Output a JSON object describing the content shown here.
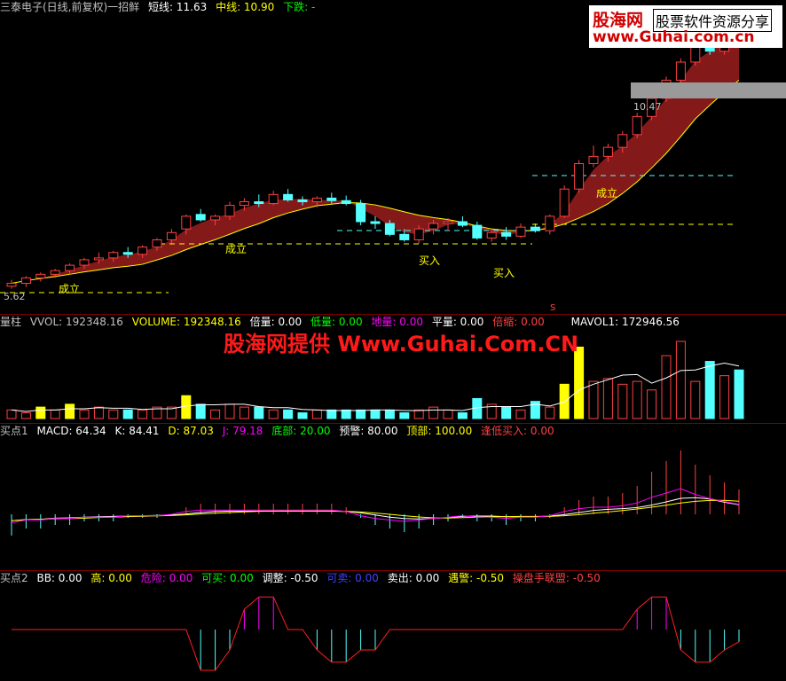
{
  "main": {
    "title": "三泰电子(日线,前复权)一招鲜",
    "short": "短线: 11.63",
    "mid": "中线: 10.90",
    "down": "下跌: -",
    "price_high": "10.47",
    "price_low": "5.62",
    "label_chengli": "成立",
    "label_buy": "买入",
    "label_s": "S"
  },
  "volume": {
    "name": "量柱",
    "vol": "VVOL: 192348.16",
    "volume": "VOLUME: 192348.16",
    "beiliang": "倍量: 0.00",
    "diliang": "低量: 0.00",
    "diliang2": "地量: 0.00",
    "pingliang": "平量: 0.00",
    "beisuo": "倍缩: 0.00",
    "mavol": "MAVOL1: 172946.56"
  },
  "macd": {
    "name": "买点1",
    "macd": "MACD: 64.34",
    "k": "K: 84.41",
    "d": "D: 87.03",
    "j": "J: 79.18",
    "dibu": "底部: 20.00",
    "yujing": "预警: 80.00",
    "dingbu": "顶部: 100.00",
    "fengdi": "逢低买入: 0.00"
  },
  "bb": {
    "name": "买点2",
    "bb": "BB: 0.00",
    "gao": "高: 0.00",
    "weixian": "危险: 0.00",
    "kemai": "可买: 0.00",
    "tiaozheng": "调整: -0.50",
    "kemai2": "可卖: 0.00",
    "maichu": "卖出: 0.00",
    "yujing": "遇警: -0.50",
    "caopan": "操盘手联盟: -0.50"
  },
  "watermark": {
    "big": "股海网提供 Www.Guhai.Com.CN",
    "logo_name": "股海网",
    "logo_tag": "股票软件资源分享",
    "logo_url": "www.Guhai.com.cn"
  },
  "colors": {
    "up": "#ff4040",
    "down": "#54ffff",
    "ribbon": "#8b1a1a",
    "yellow": "#ffff00"
  },
  "chart_data": {
    "type": "candlestick",
    "candles": [
      [
        5.62,
        5.8,
        5.55,
        5.7
      ],
      [
        5.7,
        5.9,
        5.6,
        5.85
      ],
      [
        5.85,
        6.0,
        5.75,
        5.95
      ],
      [
        5.95,
        6.1,
        5.85,
        6.05
      ],
      [
        6.05,
        6.25,
        5.95,
        6.2
      ],
      [
        6.2,
        6.4,
        6.1,
        6.35
      ],
      [
        6.35,
        6.55,
        6.25,
        6.4
      ],
      [
        6.4,
        6.6,
        6.3,
        6.55
      ],
      [
        6.55,
        6.7,
        6.4,
        6.5
      ],
      [
        6.5,
        6.75,
        6.4,
        6.7
      ],
      [
        6.7,
        6.95,
        6.6,
        6.9
      ],
      [
        6.9,
        7.2,
        6.8,
        7.1
      ],
      [
        7.2,
        7.6,
        7.05,
        7.55
      ],
      [
        7.6,
        7.75,
        7.4,
        7.45
      ],
      [
        7.45,
        7.6,
        7.3,
        7.55
      ],
      [
        7.55,
        7.95,
        7.45,
        7.85
      ],
      [
        7.85,
        8.05,
        7.7,
        7.95
      ],
      [
        7.95,
        8.15,
        7.8,
        7.9
      ],
      [
        7.9,
        8.25,
        7.85,
        8.15
      ],
      [
        8.15,
        8.3,
        7.95,
        8.0
      ],
      [
        8.0,
        8.1,
        7.85,
        7.95
      ],
      [
        7.95,
        8.1,
        7.8,
        8.05
      ],
      [
        8.05,
        8.2,
        7.9,
        7.98
      ],
      [
        7.98,
        8.12,
        7.85,
        7.9
      ],
      [
        7.9,
        8.0,
        7.3,
        7.4
      ],
      [
        7.4,
        7.55,
        7.2,
        7.35
      ],
      [
        7.35,
        7.45,
        7.0,
        7.05
      ],
      [
        7.05,
        7.2,
        6.85,
        6.9
      ],
      [
        6.9,
        7.3,
        6.8,
        7.2
      ],
      [
        7.2,
        7.45,
        7.05,
        7.35
      ],
      [
        7.35,
        7.5,
        7.15,
        7.4
      ],
      [
        7.4,
        7.55,
        7.25,
        7.3
      ],
      [
        7.3,
        7.4,
        6.9,
        6.95
      ],
      [
        6.95,
        7.2,
        6.85,
        7.1
      ],
      [
        7.1,
        7.25,
        6.9,
        7.0
      ],
      [
        7.0,
        7.35,
        6.95,
        7.25
      ],
      [
        7.25,
        7.35,
        7.1,
        7.15
      ],
      [
        7.15,
        7.6,
        7.05,
        7.55
      ],
      [
        7.55,
        8.4,
        7.5,
        8.3
      ],
      [
        8.3,
        9.1,
        8.2,
        9.0
      ],
      [
        9.0,
        9.5,
        8.9,
        9.2
      ],
      [
        9.2,
        9.55,
        9.05,
        9.45
      ],
      [
        9.45,
        9.9,
        9.3,
        9.8
      ],
      [
        9.8,
        10.4,
        9.7,
        10.3
      ],
      [
        10.3,
        10.9,
        10.2,
        10.8
      ],
      [
        10.8,
        11.4,
        10.7,
        11.3
      ],
      [
        11.3,
        11.9,
        11.2,
        11.8
      ],
      [
        11.8,
        12.5,
        11.7,
        12.4
      ],
      [
        12.4,
        12.6,
        12.0,
        12.1
      ],
      [
        12.1,
        12.7,
        12.0,
        12.6
      ],
      [
        12.6,
        12.8,
        12.3,
        12.45
      ]
    ],
    "volume": [
      3,
      2,
      4,
      3,
      5,
      3,
      4,
      3,
      3,
      3,
      4,
      4,
      8,
      5,
      3,
      5,
      4,
      4,
      3,
      3,
      2,
      3,
      3,
      3,
      3,
      3,
      3,
      2,
      3,
      4,
      3,
      2,
      7,
      5,
      4,
      3,
      6,
      4,
      12,
      25,
      13,
      14,
      12,
      13,
      10,
      22,
      27,
      13,
      20,
      15,
      17
    ],
    "macd": [
      -6,
      -4,
      -4,
      -3,
      -3,
      -2,
      -2,
      -2,
      -1,
      -1,
      -1,
      0,
      2,
      3,
      3,
      3,
      3,
      3,
      3,
      3,
      3,
      3,
      3,
      2,
      -1,
      -3,
      -4,
      -5,
      -4,
      -3,
      -2,
      -1,
      -2,
      -2,
      -3,
      -2,
      -2,
      -1,
      2,
      4,
      5,
      5,
      6,
      8,
      12,
      15,
      18,
      14,
      11,
      9,
      7
    ],
    "bb": [
      0,
      0,
      0,
      0,
      0,
      0,
      0,
      0,
      0,
      0,
      0,
      0,
      0,
      -1,
      -1,
      -0.5,
      0.5,
      0.8,
      0.8,
      0,
      0,
      -0.5,
      -0.8,
      -0.8,
      -0.5,
      -0.5,
      0,
      0,
      0,
      0,
      0,
      0,
      0,
      0,
      0,
      0,
      0,
      0,
      0,
      0,
      0,
      0,
      0,
      0.5,
      0.8,
      0.8,
      -0.5,
      -0.8,
      -0.8,
      -0.5,
      -0.3
    ]
  }
}
